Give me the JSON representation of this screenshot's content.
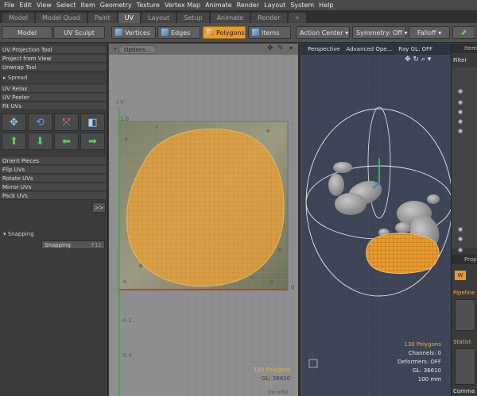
{
  "menu": [
    "File",
    "Edit",
    "View",
    "Select",
    "Item",
    "Geometry",
    "Texture",
    "Vertex Map",
    "Animate",
    "Render",
    "Layout",
    "System",
    "Help"
  ],
  "tabs": [
    {
      "label": "Model",
      "active": false
    },
    {
      "label": "Model Quad",
      "active": false
    },
    {
      "label": "Paint",
      "active": false
    },
    {
      "label": "UV",
      "active": true
    },
    {
      "label": "Layout",
      "active": false
    },
    {
      "label": "Setup",
      "active": false
    },
    {
      "label": "Animate",
      "active": false
    },
    {
      "label": "Render",
      "active": false
    },
    {
      "label": "+",
      "active": false
    }
  ],
  "toolbar": {
    "model": "Model",
    "uv_sculpt": "UV Sculpt",
    "vertices": "Vertices",
    "edges": "Edges",
    "polygons": "Polygons",
    "items": "Items",
    "action_center": "Action Center",
    "symmetry": "Symmetry: Off",
    "falloff": "Falloff"
  },
  "left_panel": {
    "tools1": [
      "UV Projection Tool",
      "Project from View",
      "Unwrap Tool"
    ],
    "spread_header": "Spread",
    "tools2": [
      "UV Relax",
      "UV Peeler",
      "Fit UVs"
    ],
    "tools3": [
      "Orient Pieces",
      "Flip UVs",
      "Rotate UVs",
      "Mirror UVs",
      "Pack UVs"
    ],
    "expand": ">>",
    "snapping_header": "Snapping",
    "snapping_label": "Snapping",
    "snapping_key": "F11"
  },
  "uv_viewport": {
    "options": "Options...",
    "axis_v": "+V",
    "tick_10": "1.0",
    "tick_0": "0",
    "tick_neg02": "-0.2",
    "tick_neg04": "-0.4",
    "polygons": "130 Polygons",
    "gl": "GL: 36610",
    "no_info": "(no info)"
  },
  "persp_viewport": {
    "title": "Perspective",
    "shading": "Advanced Ope...",
    "raygl": "Ray GL: OFF",
    "polygons": "130 Polygons",
    "channels": "Channels: 0",
    "deformers": "Deformers: OFF",
    "gl": "GL: 36610",
    "scale": "100 mm"
  },
  "right_panel": {
    "items_tab": "Item",
    "filter": "Filter",
    "props_tab": "Prop",
    "pipeline": "Pipeline",
    "statistics": "Statist",
    "commands": "Comma"
  },
  "colors": {
    "accent": "#e89b2f",
    "uv_island": "#e8a23c"
  }
}
